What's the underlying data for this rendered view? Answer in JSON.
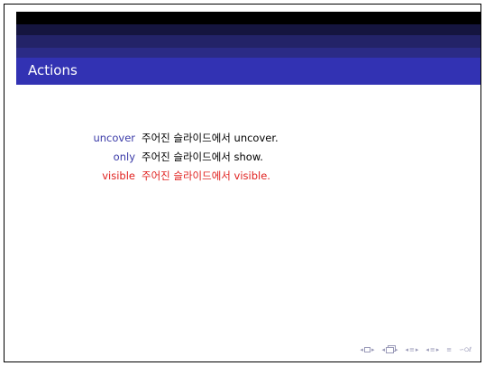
{
  "frame": {
    "title": "Actions"
  },
  "actions": [
    {
      "term": "uncover",
      "description": "주어진 슬라이드에서 uncover."
    },
    {
      "term": "only",
      "description": "주어진 슬라이드에서 show."
    },
    {
      "term": "visible",
      "description": "주어진 슬라이드에서 visible."
    }
  ],
  "navigation": {
    "prev": "◂",
    "next": "▸",
    "equiv": "≡",
    "search": "∽୦ℓ"
  },
  "colors": {
    "header_dark": "#000000",
    "header_blue": "#3232b3",
    "term_blue": "#3b3ba8",
    "alert_red": "#e0211f",
    "nav_gray": "#9a9ab8"
  }
}
